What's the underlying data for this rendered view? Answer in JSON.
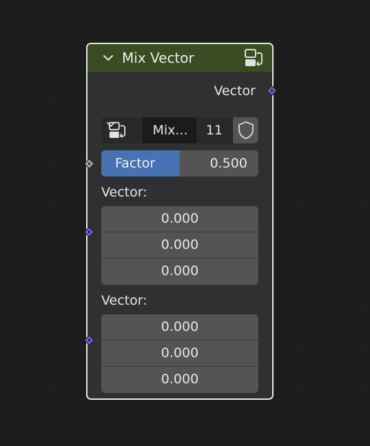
{
  "node": {
    "title": "Mix Vector",
    "header_color": "#3a4d22",
    "output": {
      "label": "Vector",
      "socket_color": "#6363c7"
    },
    "datablock": {
      "name": "Mix...",
      "users": "11",
      "type_icon": "node-tree-icon",
      "fake_user_icon": "shield-icon"
    },
    "factor": {
      "label": "Factor",
      "value": "0.500",
      "fraction": 0.5,
      "socket_color": "#a1a1a1"
    },
    "inputs": [
      {
        "label": "Vector:",
        "values": [
          "0.000",
          "0.000",
          "0.000"
        ],
        "socket_color": "#6363c7"
      },
      {
        "label": "Vector:",
        "values": [
          "0.000",
          "0.000",
          "0.000"
        ],
        "socket_color": "#6363c7"
      }
    ]
  }
}
